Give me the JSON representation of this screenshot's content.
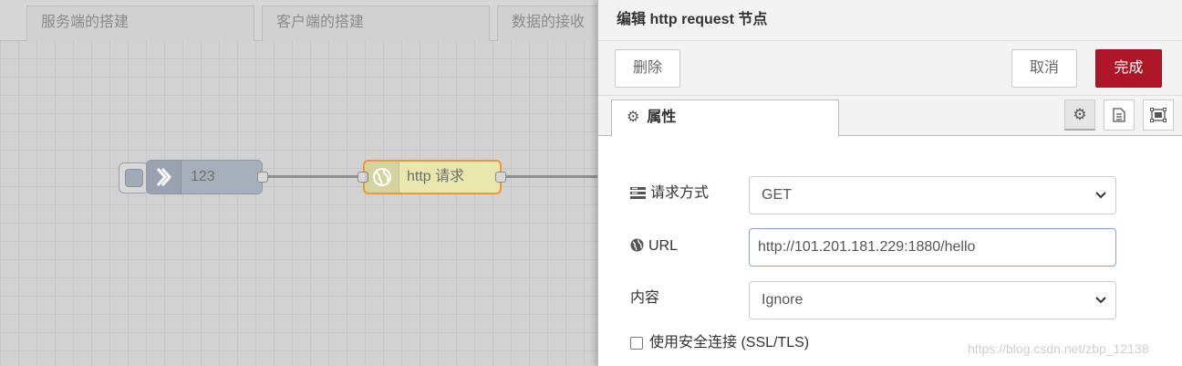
{
  "workspace": {
    "tabs": [
      {
        "label": "服务端的搭建"
      },
      {
        "label": "客户端的搭建"
      },
      {
        "label": "数据的接收"
      }
    ],
    "nodes": {
      "inject": {
        "label": "123",
        "icon": "arrow-right-icon",
        "color": "#a6b0bd"
      },
      "http_request": {
        "label": "http 请求",
        "icon": "globe-icon",
        "color": "#e7e7ae",
        "border_color": "#f29537"
      }
    }
  },
  "tray": {
    "title": "编辑 http request 节点",
    "buttons": {
      "delete": "删除",
      "cancel": "取消",
      "done": "完成"
    },
    "tabs": {
      "properties": "属性"
    },
    "form": {
      "method": {
        "label": "请求方式",
        "value": "GET"
      },
      "url": {
        "label": "URL",
        "value": "http://101.201.181.229:1880/hello"
      },
      "content": {
        "label": "内容",
        "value": "Ignore"
      },
      "ssl": {
        "label": "使用安全连接 (SSL/TLS)",
        "checked": false
      }
    }
  },
  "watermark": "https://blog.csdn.net/zbp_12138",
  "colors": {
    "accent_done": "#ad1625",
    "input_focus_border": "#85a4d6"
  }
}
